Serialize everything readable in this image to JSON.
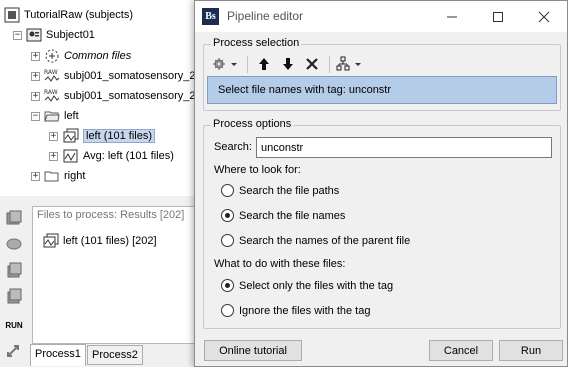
{
  "tree": {
    "root_label": "TutorialRaw (subjects)",
    "subject_label": "Subject01",
    "items": [
      {
        "label": "Common files",
        "italic": true,
        "icon": "common-files-icon"
      },
      {
        "label": "subj001_somatosensory_2",
        "icon": "raw-file-icon"
      },
      {
        "label": "subj001_somatosensory_2",
        "icon": "raw-file-icon"
      },
      {
        "label": "left",
        "icon": "folder-open-icon"
      },
      {
        "label": "left (101 files)",
        "icon": "trials-icon",
        "selected": true
      },
      {
        "label": "Avg: left (101 files)",
        "icon": "average-icon"
      },
      {
        "label": "right",
        "icon": "folder-icon"
      }
    ]
  },
  "files_panel": {
    "title": "Files to process: Results [202]",
    "entry": "left (101 files) [202]"
  },
  "left_toolbar": {
    "run_label": "RUN"
  },
  "process_tabs": [
    "Process1",
    "Process2"
  ],
  "dialog": {
    "title": "Pipeline editor",
    "app_icon_text": "Bs",
    "process_selection": {
      "title": "Process selection",
      "selected_process": "Select file names with tag: unconstr"
    },
    "process_options": {
      "title": "Process options",
      "search_label": "Search:",
      "search_value": "unconstr",
      "where_label": "Where to look for:",
      "where_options": [
        {
          "label": "Search the file paths",
          "checked": false
        },
        {
          "label": "Search the file names",
          "checked": true
        },
        {
          "label": "Search the names of the parent file",
          "checked": false
        }
      ],
      "what_label": "What to do with these files:",
      "what_options": [
        {
          "label": "Select only the files with the tag",
          "checked": true
        },
        {
          "label": "Ignore the files with the tag",
          "checked": false
        }
      ]
    },
    "buttons": {
      "online_tutorial": "Online tutorial",
      "cancel": "Cancel",
      "run": "Run"
    }
  }
}
